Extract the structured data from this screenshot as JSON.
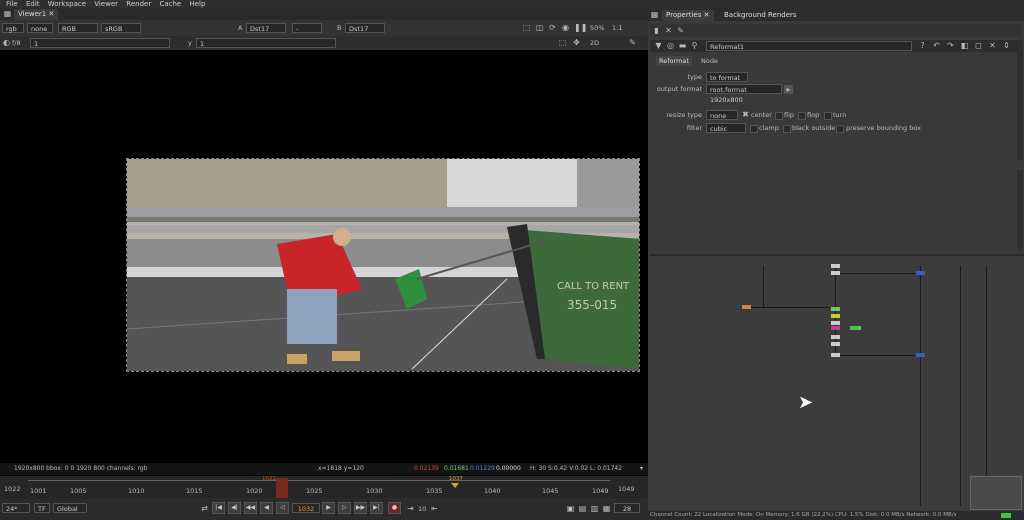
{
  "menu": [
    "File",
    "Edit",
    "Workspace",
    "Viewer",
    "Render",
    "Cache",
    "Help"
  ],
  "viewer": {
    "tab_label": "Viewer1",
    "channels": "rgb",
    "alpha": "none",
    "colorspace_in": "RGB",
    "colorspace_out": "sRGB",
    "input_a": "A",
    "input_a_name": "Dst17",
    "op": "-",
    "input_b": "B",
    "input_b_name": "Dst17",
    "zoom": "50%",
    "proxy": "1:1",
    "view_mode": "2D",
    "fstop_label": "f/8",
    "fstop_value": "1",
    "gain_label": "y",
    "gain_value": "1"
  },
  "info": {
    "format": "1920x800  bbox: 0 0 1920 800 channels: rgb",
    "coords": "x=1818 y=120",
    "r": "0.02139",
    "g": "0.01681",
    "b": "0.01229",
    "a": "0.00000",
    "hsv": "H: 30 S:0.42 V:0.02  L: 0.01742"
  },
  "timeline": {
    "start": "1022",
    "end": "1049",
    "ticks": [
      "1001",
      "1005",
      "1010",
      "1015",
      "1020",
      "1025",
      "1030",
      "1035",
      "1040",
      "1045",
      "1049"
    ],
    "current_marker": "1022",
    "key_marker": "1037"
  },
  "transport": {
    "fps": "24*",
    "tf": "TF",
    "scope": "Global",
    "current_frame": "1032",
    "increment": "10",
    "end_frame": "28"
  },
  "properties": {
    "tab_properties": "Properties",
    "tab_background": "Background Renders",
    "node_name": "Reformat1",
    "subtab_reformat": "Reformat",
    "subtab_node": "Node",
    "type_label": "type",
    "type_value": "to format",
    "output_format_label": "output format",
    "output_format_value": "root.format 1920x800",
    "resize_type_label": "resize type",
    "resize_type_value": "none",
    "center_label": "center",
    "flip_label": "flip",
    "flop_label": "flop",
    "turn_label": "turn",
    "filter_label": "filter",
    "filter_value": "cubic",
    "clamp_label": "clamp",
    "black_outside_label": "black outside",
    "preserve_bbox_label": "preserve bounding box"
  },
  "status": "Channel Count: 22  Localization Mode: On  Memory: 1.6 GB (22.2%)  CPU: 1.5%  Disk: 0.0 MB/s  Network: 0.0 MB/s",
  "colors": {
    "node_orange": "#d9824a",
    "node_green": "#4fc24f",
    "node_magenta": "#c83c9e",
    "node_yellow": "#c8c83c",
    "node_blue": "#3c5ac8",
    "status_green": "#33cc33",
    "accent_red": "#d9472b"
  }
}
